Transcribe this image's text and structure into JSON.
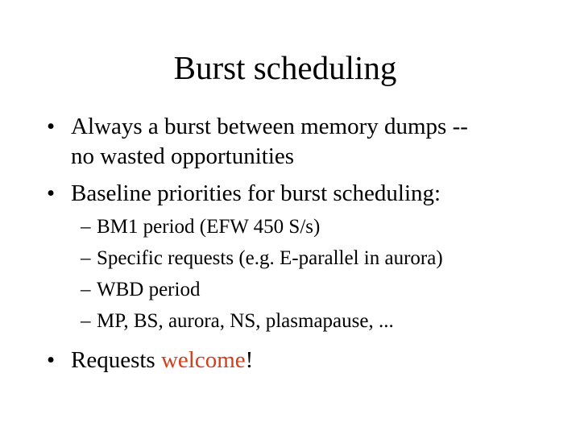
{
  "slide": {
    "title": "Burst scheduling",
    "bullets": [
      {
        "marker": "•",
        "lines": [
          "Always a burst between memory dumps --",
          "no wasted opportunities"
        ]
      },
      {
        "marker": "•",
        "lines": [
          "Baseline priorities for burst scheduling:"
        ],
        "sub_items": [
          {
            "marker": "–",
            "text": "BM1 period (EFW 450 S/s)"
          },
          {
            "marker": "–",
            "text": "Specific requests (e.g. E-parallel in aurora)"
          },
          {
            "marker": "–",
            "text": "WBD period"
          },
          {
            "marker": "–",
            "text": "MP, BS, aurora, NS, plasmapause, ..."
          }
        ]
      },
      {
        "marker": "•",
        "prefix": "Requests ",
        "highlight": "welcome",
        "suffix": "!"
      }
    ],
    "accent_color": "#D0401C"
  }
}
